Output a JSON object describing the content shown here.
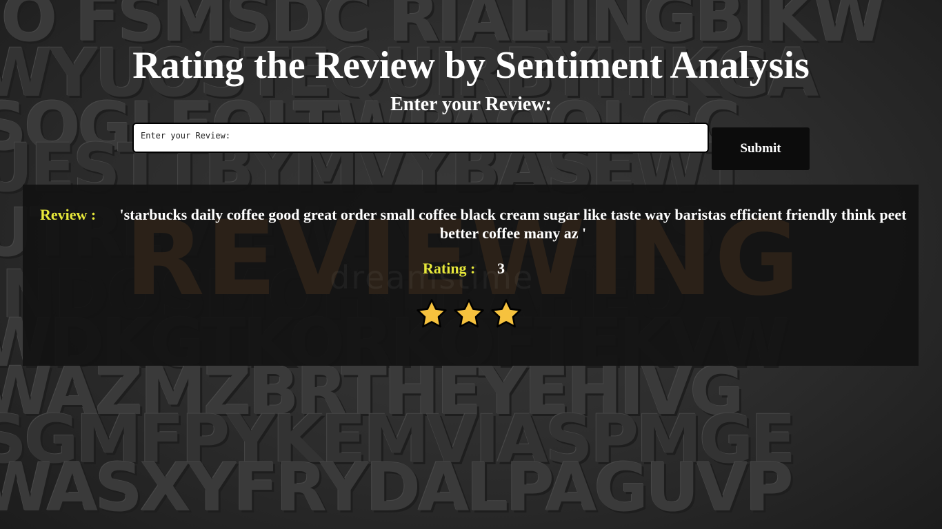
{
  "page": {
    "title": "Rating the Review by Sentiment Analysis",
    "subtitle": "Enter your Review:"
  },
  "form": {
    "input_placeholder": "Enter your Review:",
    "input_value": "",
    "submit_label": "Submit"
  },
  "result": {
    "review_label": "Review :",
    "review_text": "'starbucks daily coffee good great order small coffee black cream sugar like taste way baristas efficient friendly think peet better coffee many az '",
    "rating_label": "Rating :",
    "rating_value": "3",
    "stars_filled": 3,
    "star_icon": "star-icon"
  },
  "colors": {
    "label_yellow": "#e7e83a",
    "star_fill": "#f6c23e",
    "star_outline": "#000000",
    "button_bg": "#0c0c0c",
    "panel_bg": "#121212"
  }
}
